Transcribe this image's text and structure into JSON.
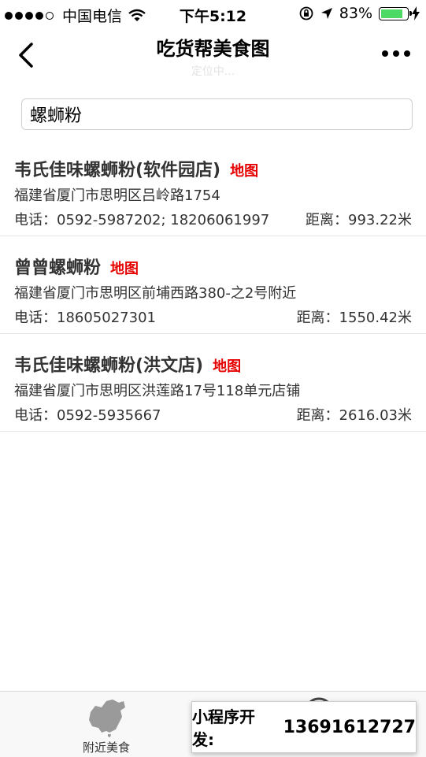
{
  "status_bar": {
    "carrier": "中国电信",
    "time": "下午5:12",
    "battery_percent": "83%",
    "battery_level": 0.83
  },
  "nav": {
    "title": "吃货帮美食图",
    "subtitle": "定位中..."
  },
  "search": {
    "value": "螺蛳粉"
  },
  "results": [
    {
      "name": "韦氏佳味螺蛳粉(软件园店)",
      "map_label": "地图",
      "address": "福建省厦门市思明区吕岭路1754",
      "phone": "电话：0592-5987202; 18206061997",
      "distance": "距离：993.22米"
    },
    {
      "name": "曾曾螺蛳粉",
      "map_label": "地图",
      "address": "福建省厦门市思明区前埔西路380-之2号附近",
      "phone": "电话：18605027301",
      "distance": "距离：1550.42米"
    },
    {
      "name": "韦氏佳味螺蛳粉(洪文店)",
      "map_label": "地图",
      "address": "福建省厦门市思明区洪莲路17号118单元店铺",
      "phone": "电话：0592-5935667",
      "distance": "距离：2616.03米"
    }
  ],
  "tabbar": {
    "tab1_label": "附近美食"
  },
  "ad": {
    "label": "小程序开发:",
    "phone": "13691612727"
  }
}
